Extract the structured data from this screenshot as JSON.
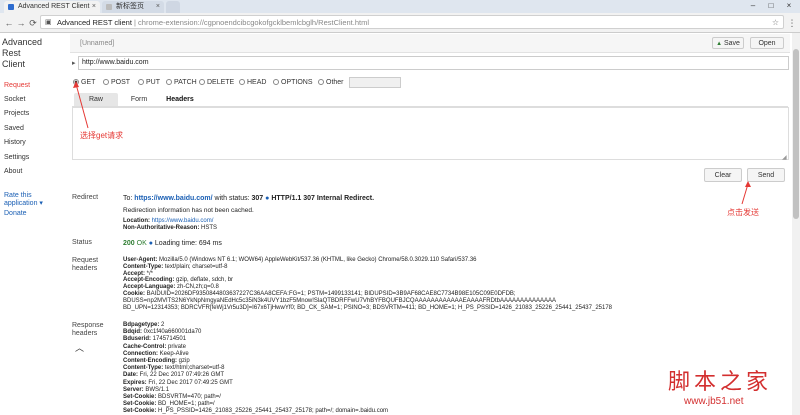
{
  "browser": {
    "tabs": [
      {
        "title": "Advanced REST Client"
      },
      {
        "title": "新标签页"
      }
    ],
    "address": {
      "host": "Advanced REST client",
      "path": "chrome-extension://cgpnoendcibcgokofgcklbemlcbglh/RestClient.html"
    }
  },
  "sidebar": {
    "title_line1": "Advanced Rest",
    "title_line2": "Client",
    "items": [
      "Request",
      "Socket",
      "Projects",
      "Saved",
      "History",
      "Settings",
      "About"
    ],
    "rate_line1": "Rate this",
    "rate_line2": "application ▾",
    "donate": "Donate"
  },
  "request": {
    "name": "[Unnamed]",
    "save": "Save",
    "open": "Open",
    "url": "http://www.baidu.com",
    "methods": [
      "GET",
      "POST",
      "PUT",
      "PATCH",
      "DELETE",
      "HEAD",
      "OPTIONS",
      "Other"
    ],
    "selected_method": "GET",
    "tabs": [
      "Raw",
      "Form",
      "Headers"
    ],
    "clear": "Clear",
    "send": "Send"
  },
  "annotations": {
    "get": "选择get请求",
    "send": "点击发送"
  },
  "response": {
    "redirect_label": "Redirect",
    "redirect_to_prefix": "To:",
    "redirect_url": "https://www.baidu.com/",
    "redirect_with": "with status:",
    "redirect_code": "307",
    "redirect_status": "HTTP/1.1 307 Internal Redirect.",
    "redirect_note": "Redirection information has not been cached.",
    "location_key": "Location:",
    "location_val": "https://www.baidu.com/",
    "nonauth_key": "Non-Authoritative-Reason:",
    "nonauth_val": "HSTS",
    "status_label": "Status",
    "status_code": "200",
    "status_text": "OK",
    "loading_label": "Loading time:",
    "loading_val": "694 ms",
    "req_headers_label1": "Request",
    "req_headers_label2": "headers",
    "request_headers": [
      {
        "k": "User-Agent:",
        "v": "Mozilla/5.0 (Windows NT 6.1; WOW64) AppleWebKit/537.36 (KHTML, like Gecko) Chrome/58.0.3029.110 Safari/537.36"
      },
      {
        "k": "Content-Type:",
        "v": "text/plain; charset=utf-8"
      },
      {
        "k": "Accept:",
        "v": "*/*"
      },
      {
        "k": "Accept-Encoding:",
        "v": "gzip, deflate, sdch, br"
      },
      {
        "k": "Accept-Language:",
        "v": "zh-CN,zh;q=0.8"
      },
      {
        "k": "Cookie:",
        "v": "BAIDUID=2026DF9350844803637227C36AA8CEFA:FG=1; PSTM=1499133141; BIDUPSID=3B9AF68CAE8C7734B98E105C09E0DFDB;"
      },
      {
        "k": "",
        "v": "BDUSS=np2MVlTS2N6YkNpNmgyaNEdHc5c35iN3k4UVY1bzF5Mnow!SlaQTBDRFFwU7VhBYFBQUFBJCQAAAAAAAAAAAAEAAAAFRDtbAAAAAAAAAAAAAA"
      },
      {
        "k": "",
        "v": "BD_UPN=12314353; BDRCVFR[feWj1Vr5u3D]=I67x6TjHwwYf0; BD_CK_SAM=1; PSINO=3; BDSVRTM=411; BD_HOME=1; H_PS_PSSID=1426_21083_25226_25441_25437_25178"
      }
    ],
    "resp_headers_label1": "Response",
    "resp_headers_label2": "headers",
    "response_headers": [
      {
        "k": "Bdpagetype:",
        "v": "2"
      },
      {
        "k": "Bdqid:",
        "v": "0xc1f40a660001da70"
      },
      {
        "k": "Bduserid:",
        "v": "1745714501"
      },
      {
        "k": "Cache-Control:",
        "v": "private"
      },
      {
        "k": "Connection:",
        "v": "Keep-Alive"
      },
      {
        "k": "Content-Encoding:",
        "v": "gzip"
      },
      {
        "k": "Content-Type:",
        "v": "text/html;charset=utf-8"
      },
      {
        "k": "Date:",
        "v": "Fri, 22 Dec 2017 07:49:26 GMT"
      },
      {
        "k": "Expires:",
        "v": "Fri, 22 Dec 2017 07:49:25 GMT"
      },
      {
        "k": "Server:",
        "v": "BWS/1.1"
      },
      {
        "k": "Set-Cookie:",
        "v": "BDSVRTM=470; path=/"
      },
      {
        "k": "Set-Cookie:",
        "v": "BD_HOME=1; path=/"
      },
      {
        "k": "Set-Cookie:",
        "v": "H_PS_PSSID=1426_21083_25226_25441_25437_25178; path=/; domain=.baidu.com"
      }
    ]
  },
  "watermark": {
    "brand": "脚本之家",
    "url": "www.jb51.net"
  },
  "colors": {
    "accent_red": "#e53935",
    "link_blue": "#1a5fb4",
    "status_green": "#2e7d32"
  }
}
